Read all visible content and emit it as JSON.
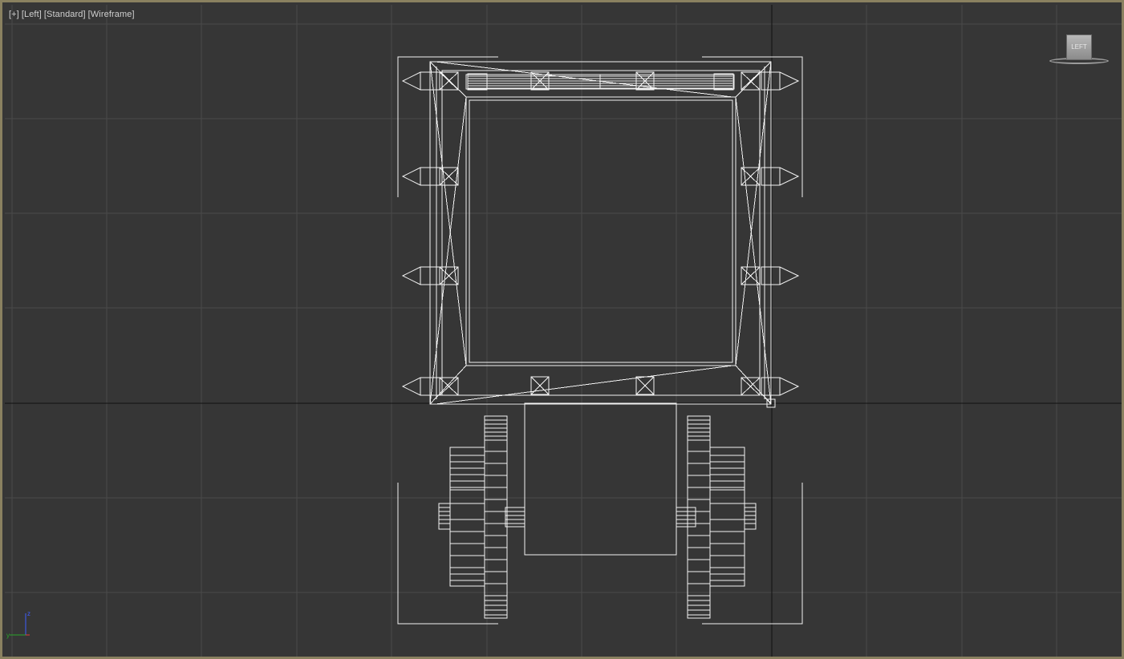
{
  "viewport": {
    "labels": {
      "plus": "[+]",
      "view": "[Left]",
      "shading_mode": "[Standard]",
      "display_mode": "[Wireframe]"
    },
    "viewcube_face": "LEFT",
    "axis": {
      "z": "z",
      "y": "y"
    }
  },
  "colors": {
    "background": "#363636",
    "grid": "#4a4a4a",
    "home_grid_axis": "#101010",
    "wireframe": "#f3f3f3",
    "selection_bracket": "#ffffff",
    "viewport_border": "#8a8160",
    "axis_z": "#3f5dff",
    "axis_y": "#2aa62a",
    "axis_x": "#e23b3b"
  },
  "icons": {
    "viewcube": "viewcube-icon",
    "axis_tripod": "axis-tripod-icon",
    "pivot": "pivot-marker-icon"
  }
}
